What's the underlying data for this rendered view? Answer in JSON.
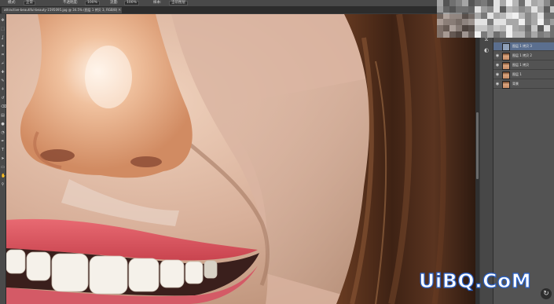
{
  "options_bar": {
    "items": [
      "模式:",
      "正常",
      "不透明度:",
      "100%",
      "流量:",
      "100%",
      "样本:",
      "当前图层"
    ]
  },
  "document_tab": {
    "title": "attractive-beautiful-beauty-1595095.jpg @ 34.5% (图层 1 拷贝 3, RGB/8)",
    "close_glyph": "×"
  },
  "toolbar": {
    "icons": [
      "move-icon",
      "marquee-icon",
      "lasso-icon",
      "wand-icon",
      "crop-icon",
      "eyedropper-icon",
      "healing-icon",
      "brush-icon",
      "stamp-icon",
      "history-brush-icon",
      "eraser-icon",
      "gradient-icon",
      "blur-icon",
      "dodge-icon",
      "pen-icon",
      "type-icon",
      "path-select-icon",
      "shape-icon",
      "hand-icon",
      "zoom-icon"
    ]
  },
  "dock": {
    "icons": [
      "history-icon",
      "adjust-icon",
      "properties-icon"
    ]
  },
  "layers": {
    "rows": [
      {
        "name": "图层 1 拷贝 3",
        "active": true,
        "visible": false
      },
      {
        "name": "图层 1 拷贝 2",
        "active": false,
        "visible": true
      },
      {
        "name": "图层 1 拷贝",
        "active": false,
        "visible": true
      },
      {
        "name": "图层 1",
        "active": false,
        "visible": true
      },
      {
        "name": "背景",
        "active": false,
        "visible": true
      }
    ],
    "eye_glyph": "◉"
  },
  "watermark": "UiBQ.CoM",
  "colors": {
    "ui_dark": "#3b3b3b",
    "panel": "#535353",
    "active_layer": "#5b6f8f",
    "watermark_outline": "#2a63c9"
  }
}
